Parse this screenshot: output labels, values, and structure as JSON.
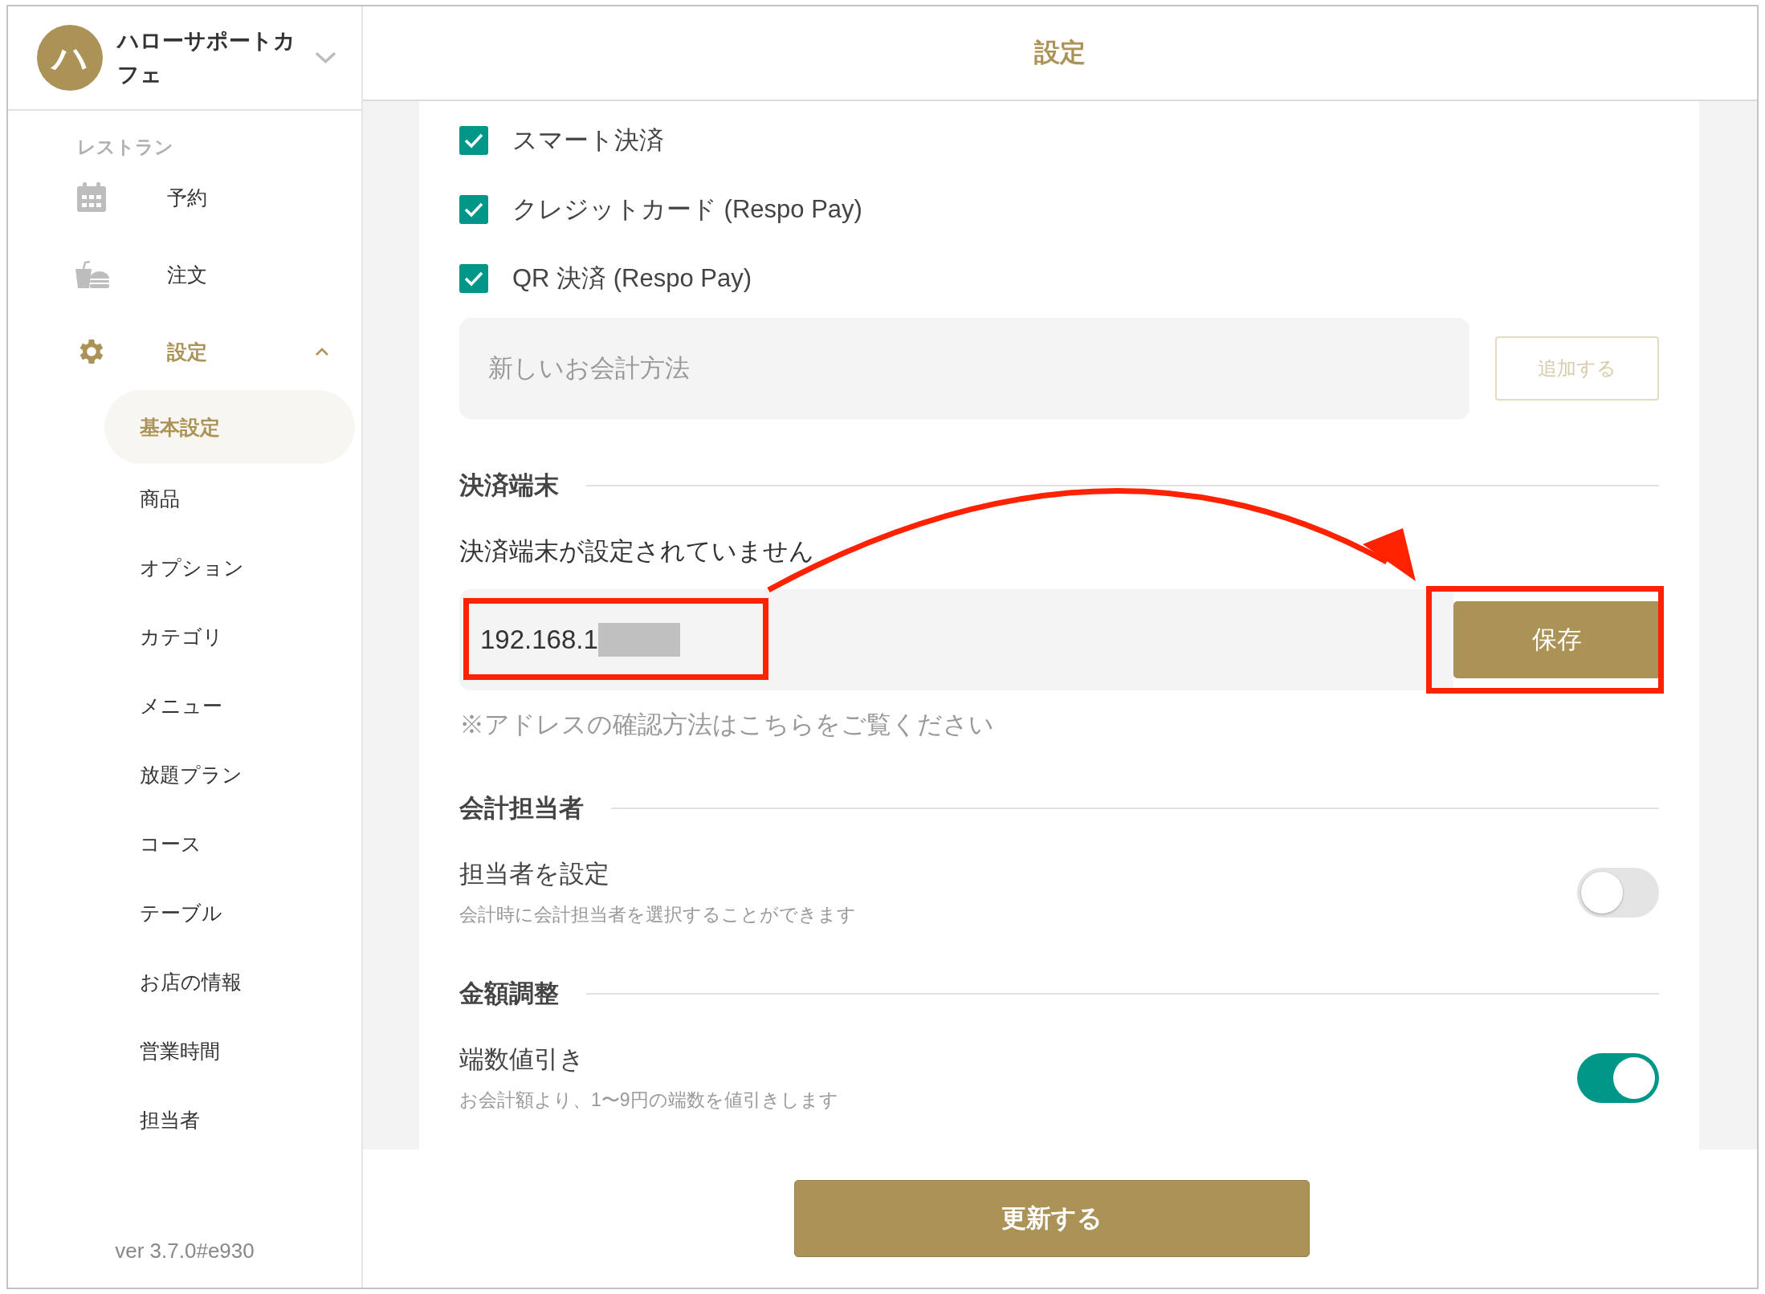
{
  "sidebar": {
    "account": {
      "initial": "ハ",
      "name": "ハローサポートカフェ"
    },
    "section": "レストラン",
    "items": [
      {
        "label": "予約",
        "selected": false
      },
      {
        "label": "注文",
        "selected": false
      },
      {
        "label": "設定",
        "selected": true,
        "expanded": true,
        "children": [
          {
            "label": "基本設定",
            "selected": true
          },
          {
            "label": "商品",
            "selected": false
          },
          {
            "label": "オプション",
            "selected": false
          },
          {
            "label": "カテゴリ",
            "selected": false
          },
          {
            "label": "メニュー",
            "selected": false
          },
          {
            "label": "放題プラン",
            "selected": false
          },
          {
            "label": "コース",
            "selected": false
          },
          {
            "label": "テーブル",
            "selected": false
          },
          {
            "label": "お店の情報",
            "selected": false
          },
          {
            "label": "営業時間",
            "selected": false
          },
          {
            "label": "担当者",
            "selected": false
          }
        ]
      }
    ],
    "version": "ver 3.7.0#e930"
  },
  "header": {
    "title": "設定"
  },
  "payment_methods": [
    {
      "label": "スマート決済",
      "checked": true
    },
    {
      "label": "クレジットカード (Respo Pay)",
      "checked": true
    },
    {
      "label": "QR 決済 (Respo Pay)",
      "checked": true
    }
  ],
  "new_method": {
    "placeholder": "新しいお会計方法",
    "button": "追加する",
    "disabled": true
  },
  "terminal": {
    "heading": "決済端末",
    "status": "決済端末が設定されていません",
    "value": "192.168.1",
    "button": "保存",
    "note": "※アドレスの確認方法はこちらをご覧ください"
  },
  "sections": [
    {
      "heading": "会計担当者",
      "settings": [
        {
          "label": "担当者を設定",
          "description": "会計時に会計担当者を選択することができます",
          "on": false
        }
      ]
    },
    {
      "heading": "金額調整",
      "settings": [
        {
          "label": "端数値引き",
          "description": "お会計額より、1〜9円の端数を値引きします",
          "on": true
        }
      ]
    }
  ],
  "footer": {
    "button": "更新する"
  }
}
